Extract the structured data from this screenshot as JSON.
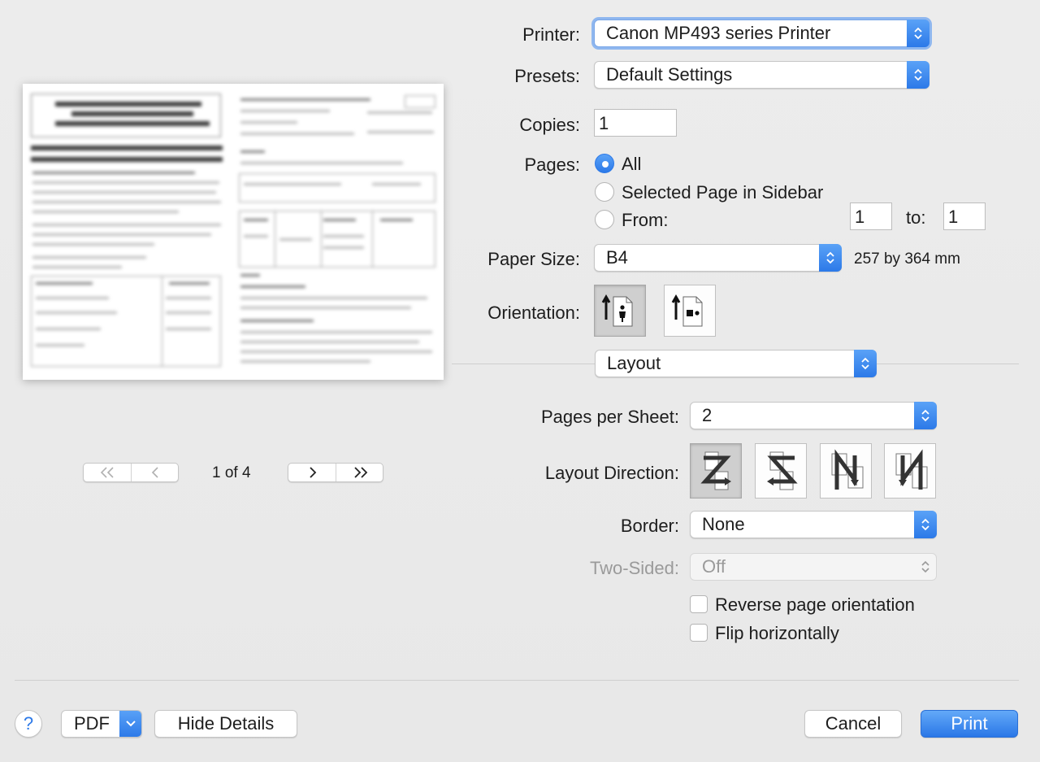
{
  "printer": {
    "label": "Printer:",
    "value": "Canon MP493 series Printer"
  },
  "presets": {
    "label": "Presets:",
    "value": "Default Settings"
  },
  "copies": {
    "label": "Copies:",
    "value": "1"
  },
  "pages": {
    "label": "Pages:",
    "options": [
      {
        "label": "All",
        "selected": true
      },
      {
        "label": "Selected Page in Sidebar",
        "selected": false
      },
      {
        "label": "From:",
        "selected": false
      }
    ],
    "from": "1",
    "to_label": "to:",
    "to": "1"
  },
  "paper_size": {
    "label": "Paper Size:",
    "value": "B4",
    "dimensions": "257 by 364 mm"
  },
  "orientation": {
    "label": "Orientation:",
    "selected": "portrait"
  },
  "section_popup": {
    "value": "Layout"
  },
  "pages_per_sheet": {
    "label": "Pages per Sheet:",
    "value": "2"
  },
  "layout_direction": {
    "label": "Layout Direction:",
    "selected": "z-right-then-down"
  },
  "border": {
    "label": "Border:",
    "value": "None"
  },
  "two_sided": {
    "label": "Two-Sided:",
    "value": "Off",
    "enabled": false
  },
  "reverse_orientation": {
    "label": "Reverse page orientation",
    "checked": false
  },
  "flip_horizontally": {
    "label": "Flip horizontally",
    "checked": false
  },
  "preview": {
    "page_indicator": "1 of 4"
  },
  "footer": {
    "help": "?",
    "pdf": "PDF",
    "hide_details": "Hide Details",
    "cancel": "Cancel",
    "print": "Print"
  },
  "colors": {
    "accent": "#2c79e8",
    "focus_ring": "#8fb7ef"
  }
}
